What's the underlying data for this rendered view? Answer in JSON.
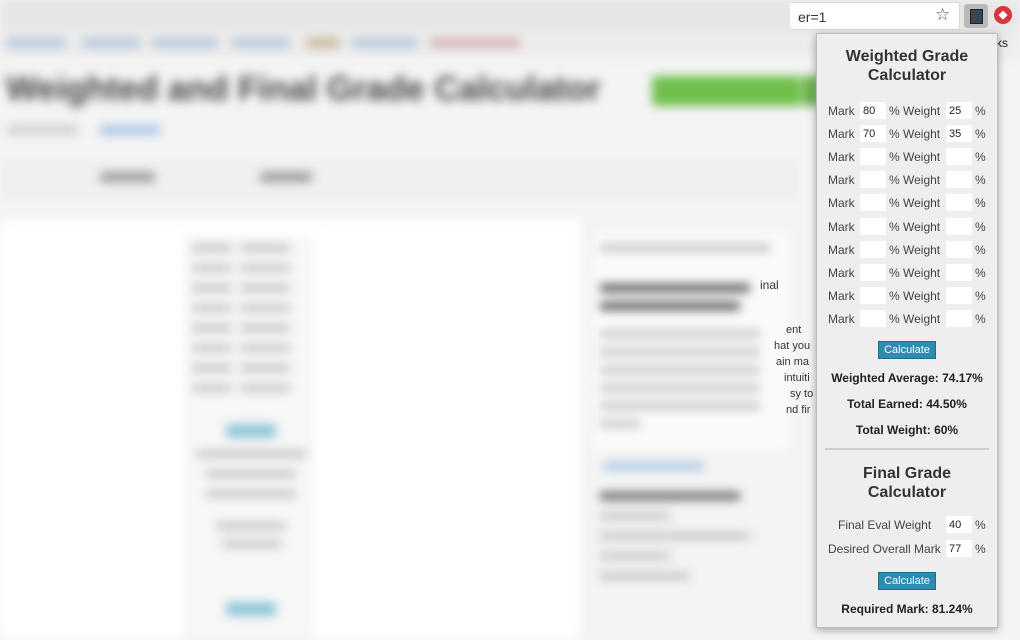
{
  "browser": {
    "url_tail": "er=1",
    "bookmarks_tail": "ks",
    "abp_glyph": "◆"
  },
  "background_page": {
    "title": "Weighted and Final Grade Calculator",
    "sidebar_snippets": [
      "inal",
      "ent",
      "hat you",
      "ain ma",
      "intuiti",
      "sy to",
      "nd fir"
    ]
  },
  "popup": {
    "weighted": {
      "title_line1": "Weighted Grade",
      "title_line2": "Calculator",
      "mark_label": "Mark",
      "weight_label": "Weight",
      "percent_sign": "%",
      "rows": [
        {
          "mark": "80",
          "weight": "25"
        },
        {
          "mark": "70",
          "weight": "35"
        },
        {
          "mark": "",
          "weight": ""
        },
        {
          "mark": "",
          "weight": ""
        },
        {
          "mark": "",
          "weight": ""
        },
        {
          "mark": "",
          "weight": ""
        },
        {
          "mark": "",
          "weight": ""
        },
        {
          "mark": "",
          "weight": ""
        },
        {
          "mark": "",
          "weight": ""
        },
        {
          "mark": "",
          "weight": ""
        }
      ],
      "calculate_label": "Calculate",
      "weighted_average": "Weighted Average: 74.17%",
      "total_earned": "Total Earned: 44.50%",
      "total_weight": "Total Weight: 60%"
    },
    "final": {
      "title_line1": "Final Grade",
      "title_line2": "Calculator",
      "final_eval_label": "Final Eval Weight",
      "final_eval_value": "40",
      "desired_label": "Desired Overall Mark",
      "desired_value": "77",
      "percent_sign": "%",
      "calculate_label": "Calculate",
      "required_mark": "Required Mark: 81.24%"
    }
  },
  "colors": {
    "button": "#2e8cb0",
    "popup_bg": "#eeeeee",
    "accent_green": "#6fbf4a"
  }
}
